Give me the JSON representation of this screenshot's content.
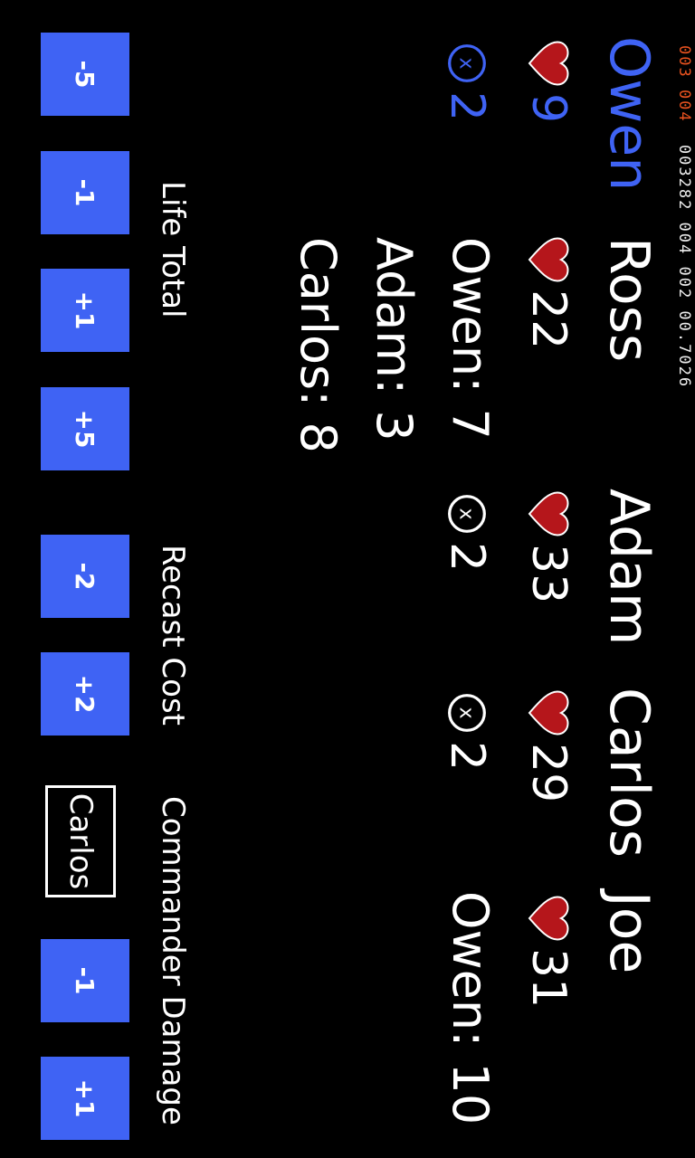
{
  "status_text": {
    "part1": "003 004",
    "part2": "003282 004 002 00.7026"
  },
  "players": [
    {
      "name": "Owen",
      "life": "9",
      "recast": "2",
      "active": true
    },
    {
      "name": "Ross",
      "life": "22",
      "recast": "",
      "active": false
    },
    {
      "name": "Adam",
      "life": "33",
      "recast": "2",
      "active": false
    },
    {
      "name": "Carlos",
      "life": "29",
      "recast": "2",
      "active": false
    },
    {
      "name": "Joe",
      "life": "31",
      "recast": "",
      "active": false
    }
  ],
  "commander_damage": {
    "ross": [
      "Owen: 7",
      "Adam: 3",
      "Carlos: 8"
    ],
    "joe": [
      "Owen: 10"
    ]
  },
  "sections": {
    "life_total": "Life Total",
    "recast_cost": "Recast Cost",
    "commander_damage": "Commander Damage"
  },
  "buttons": {
    "life": [
      "-5",
      "-1",
      "+1",
      "+5"
    ],
    "recast": [
      "-2",
      "+2"
    ],
    "damage": [
      "-1",
      "+1"
    ]
  },
  "commander_select": {
    "selected": "Carlos"
  },
  "colors": {
    "accent": "#3f63f4",
    "heart": "#b5161b",
    "background": "#000000"
  }
}
